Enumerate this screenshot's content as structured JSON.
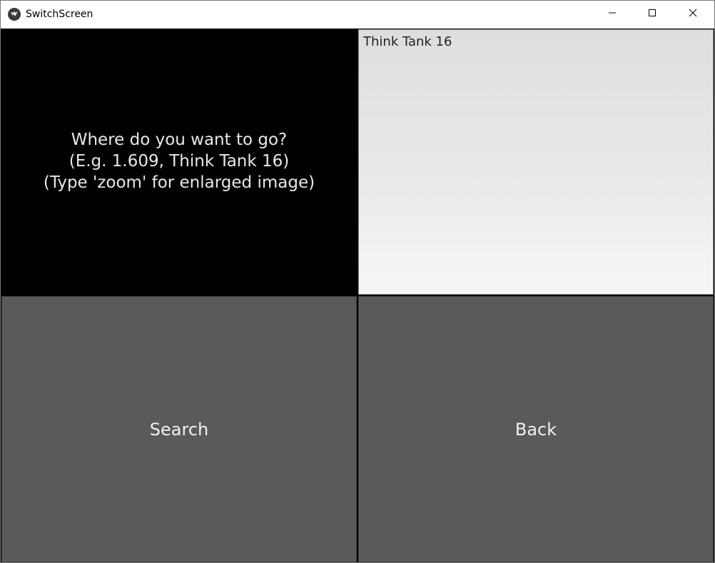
{
  "window": {
    "title": "SwitchScreen",
    "icon": "kivy-app-icon",
    "controls": {
      "minimize_icon": "minimize-icon",
      "maximize_icon": "maximize-icon",
      "close_icon": "close-icon"
    }
  },
  "prompt": {
    "line1": "Where do you want to go?",
    "line2": "(E.g. 1.609, Think Tank 16)",
    "line3": "(Type 'zoom' for enlarged image)"
  },
  "input": {
    "value": "Think Tank 16"
  },
  "buttons": {
    "search_label": "Search",
    "back_label": "Back"
  },
  "colors": {
    "prompt_bg": "#000000",
    "button_bg": "#5a5a5a",
    "text_light": "#e8e8e8"
  }
}
